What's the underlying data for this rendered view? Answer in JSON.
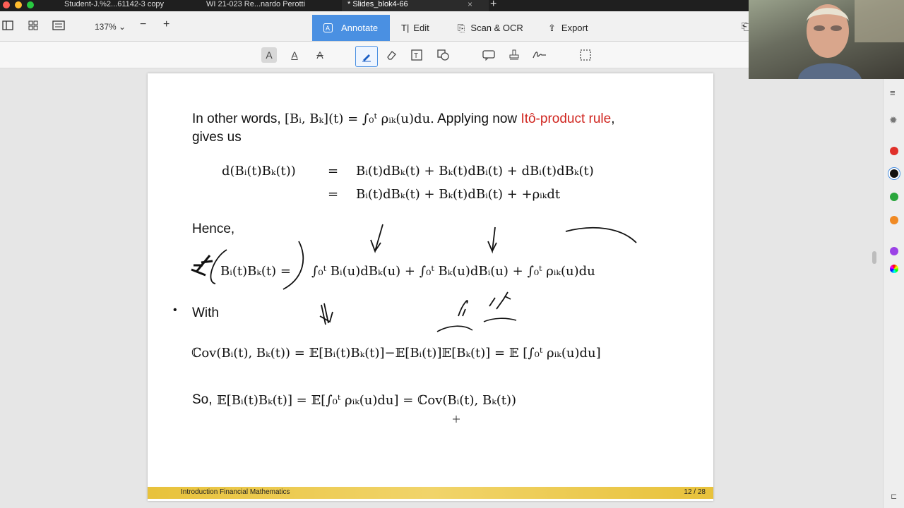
{
  "tabs": [
    {
      "label": "Student-J.%2...61142-3 copy",
      "active": false
    },
    {
      "label": "WI 21-023 Re...nardo Perotti",
      "active": false
    },
    {
      "label": "* Slides_blok4-66",
      "active": true
    }
  ],
  "toolbar": {
    "zoom": "137%",
    "zoom_out": "−",
    "zoom_in": "+",
    "modes": [
      "Annotate",
      "Edit",
      "Scan & OCR",
      "Export"
    ],
    "active_mode": "Annotate"
  },
  "colors": {
    "accent": "#4a90e2",
    "highlight_text": "#d0241e",
    "footer": "#e8c23b",
    "palette": [
      "#e0302a",
      "#111111",
      "#2aa63c",
      "#f08a24",
      "#9b42e6"
    ]
  },
  "slide": {
    "line1_prefix": "In other words,",
    "line1_math": "[Bᵢ, Bₖ](t) = ∫₀ᵗ ρᵢₖ(u)du.",
    "line1_mid": "Applying now",
    "line1_link": "Itô-product rule",
    "line1_end": ",",
    "line2": "gives us",
    "eq1_lhs": "d(Bᵢ(t)Bₖ(t))",
    "eq1_eq": "=",
    "eq1_rhs": "Bᵢ(t)dBₖ(t) + Bₖ(t)dBᵢ(t) + dBᵢ(t)dBₖ(t)",
    "eq2_eq": "=",
    "eq2_rhs": "Bᵢ(t)dBₖ(t) + Bₖ(t)dBᵢ(t) + +ρᵢₖdt",
    "hence": "Hence,",
    "eq3_lhs": "Bᵢ(t)Bₖ(t) =",
    "eq3_rhs": "∫₀ᵗ Bᵢ(u)dBₖ(u) + ∫₀ᵗ Bₖ(u)dBᵢ(u) + ∫₀ᵗ ρᵢₖ(u)du",
    "bullet": "•",
    "with": "With",
    "cov_eq": "ℂov(Bᵢ(t), Bₖ(t)) = 𝔼[Bᵢ(t)Bₖ(t)]−𝔼[Bᵢ(t)]𝔼[Bₖ(t)] = 𝔼 [∫₀ᵗ ρᵢₖ(u)du]",
    "so_prefix": "So,",
    "so_eq": "𝔼[Bᵢ(t)Bₖ(t)] = 𝔼[∫₀ᵗ ρᵢₖ(u)du] = ℂov(Bᵢ(t), Bₖ(t))",
    "footer_title": "Introduction Financial Mathematics",
    "footer_page": "12 / 28"
  }
}
